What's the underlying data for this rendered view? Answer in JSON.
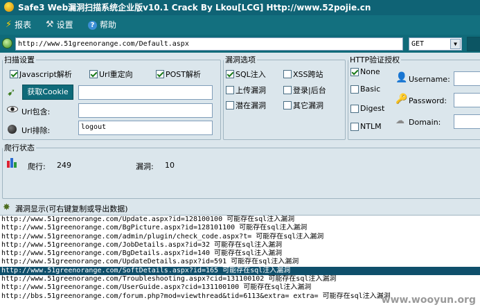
{
  "window": {
    "title": "Safe3 Web漏洞扫描系统企业版v10.1  Crack By Lkou[LCG]  Http://www.52pojie.cn"
  },
  "menu": {
    "report": "报表",
    "settings": "设置",
    "help": "帮助"
  },
  "url_bar": {
    "value": "http://www.51greenorange.com/Default.aspx",
    "method": "GET"
  },
  "scan_settings": {
    "legend": "扫描设置",
    "javascript": {
      "label": "Javascript解析",
      "checked": true
    },
    "url_redirect": {
      "label": "Url重定向",
      "checked": true
    },
    "post": {
      "label": "POST解析",
      "checked": true
    },
    "get_cookie": "获取Cookie",
    "cookie_value": "",
    "url_include_label": "Url包含:",
    "url_include_value": "",
    "url_exclude_label": "Url排除:",
    "url_exclude_value": "logout"
  },
  "vuln_options": {
    "legend": "漏洞选项",
    "sql": {
      "label": "SQL注入",
      "checked": true
    },
    "xss": {
      "label": "XSS跨站",
      "checked": false
    },
    "upload": {
      "label": "上传漏洞",
      "checked": false
    },
    "login": {
      "label": "登录|后台",
      "checked": false
    },
    "latent": {
      "label": "潜在漏洞",
      "checked": false
    },
    "other": {
      "label": "其它漏洞",
      "checked": false
    }
  },
  "http_auth": {
    "legend": "HTTP验证授权",
    "none": {
      "label": "None",
      "checked": true
    },
    "basic": {
      "label": "Basic",
      "checked": false
    },
    "digest": {
      "label": "Digest",
      "checked": false
    },
    "ntlm": {
      "label": "NTLM",
      "checked": false
    },
    "username_label": "Username:",
    "password_label": "Password:",
    "domain_label": "Domain:"
  },
  "crawl_status": {
    "legend": "爬行状态",
    "crawl_label": "爬行:",
    "crawl_count": "249",
    "vuln_label": "漏洞:",
    "vuln_count": "10"
  },
  "vuln_display": {
    "title": "漏洞显示(可右键复制或导出数据)",
    "rows": [
      "http://www.51greenorange.com/Update.aspx?id=128100100 可能存在sql注入漏洞",
      "http://www.51greenorange.com/BgPicture.aspx?id=128101100 可能存在sql注入漏洞",
      "http://www.51greenorange.com/admin/plugin/check_code.aspx?t= 可能存在sql注入漏洞",
      "http://www.51greenorange.com/JobDetails.aspx?id=32 可能存在sql注入漏洞",
      "http://www.51greenorange.com/BgDetails.aspx?id=140 可能存在sql注入漏洞",
      "http://www.51greenorange.com/UpdateDetails.aspx?id=591 可能存在sql注入漏洞",
      "http://www.51greenorange.com/SoftDetails.aspx?id=165 可能存在sql注入漏洞",
      "http://www.51greenorange.com/Troubleshooting.aspx?cid=131100102 可能存在sql注入漏洞",
      "http://www.51greenorange.com/UserGuide.aspx?cid=131100100 可能存在sql注入漏洞",
      "http://bbs.51greenorange.com/forum.php?mod=viewthread&tid=6113&extra= extra= 可能存在sql注入漏洞"
    ],
    "selected_index": 6
  },
  "watermark": "www.wooyun.org"
}
